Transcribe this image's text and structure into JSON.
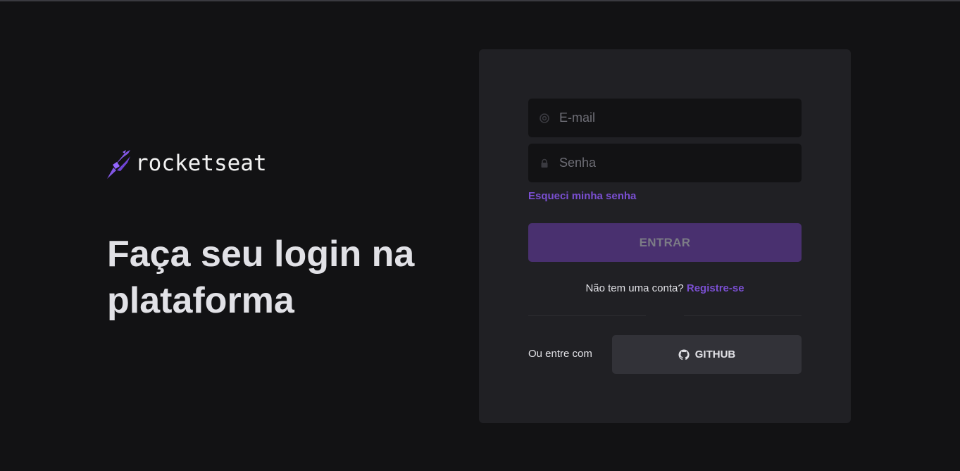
{
  "brand": {
    "name": "rocketseat",
    "logo_icon": "rocket-icon",
    "accent": "#8257e5"
  },
  "hero": {
    "headline": "Faça seu login na plataforma"
  },
  "form": {
    "email": {
      "placeholder": "E-mail",
      "value": "",
      "icon": "at-sign-icon"
    },
    "password": {
      "placeholder": "Senha",
      "value": "",
      "icon": "lock-icon"
    },
    "forgot_label": "Esqueci minha senha",
    "submit_label": "ENTRAR",
    "no_account_text": "Não tem uma conta?",
    "register_label": "Registre-se"
  },
  "social": {
    "or_label": "Ou entre com",
    "github_label": "GITHUB",
    "github_icon": "github-icon"
  },
  "colors": {
    "background": "#121214",
    "card": "#202024",
    "input": "#121214",
    "link": "#7a4fd1",
    "button_disabled": "#49306f"
  }
}
